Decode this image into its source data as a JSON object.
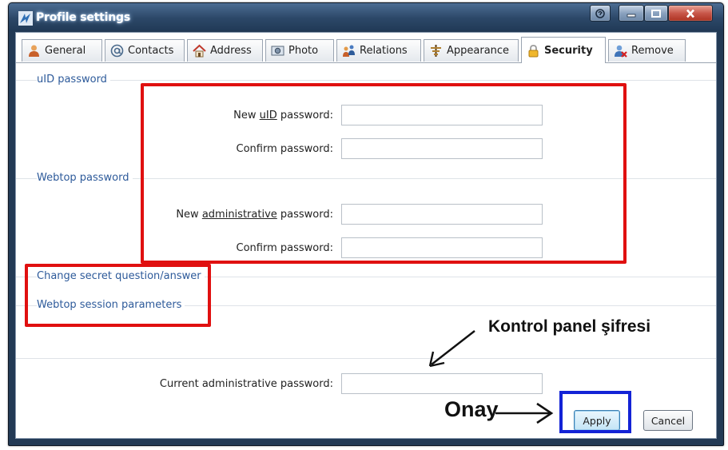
{
  "window": {
    "title": "Profile settings",
    "colors": {
      "titlebar": "#2c4868",
      "section_label": "#2d5a9a",
      "annotation_red": "#e01010",
      "annotation_blue": "#1323d6"
    },
    "controls": [
      "help-icon",
      "minimize-icon",
      "maximize-icon",
      "close-icon"
    ]
  },
  "tabs": [
    {
      "label": "General",
      "icon": "user-icon"
    },
    {
      "label": "Contacts",
      "icon": "at-sign-icon"
    },
    {
      "label": "Address",
      "icon": "house-icon"
    },
    {
      "label": "Photo",
      "icon": "photo-icon"
    },
    {
      "label": "Relations",
      "icon": "relations-icon"
    },
    {
      "label": "Appearance",
      "icon": "appearance-icon"
    },
    {
      "label": "Security",
      "icon": "lock-icon",
      "active": true
    },
    {
      "label": "Remove",
      "icon": "remove-user-icon"
    }
  ],
  "sections": {
    "uid": "uID password",
    "webtop": "Webtop password",
    "secret": "Change secret question/answer",
    "session": "Webtop session parameters"
  },
  "fields": {
    "new_uid_pre": "New ",
    "new_uid_u": "uID",
    "new_uid_post": " password:",
    "confirm1": "Confirm password:",
    "new_admin_pre": "New ",
    "new_admin_u": "administrative",
    "new_admin_post": " password:",
    "confirm2": "Confirm password:",
    "current_admin": "Current administrative password:",
    "values": {
      "new_uid": "",
      "confirm1": "",
      "new_admin": "",
      "confirm2": "",
      "current_admin": ""
    }
  },
  "buttons": {
    "apply": "Apply",
    "cancel": "Cancel"
  },
  "annotations": {
    "kontrol": "Kontrol panel şifresi",
    "onay": "Onay"
  }
}
